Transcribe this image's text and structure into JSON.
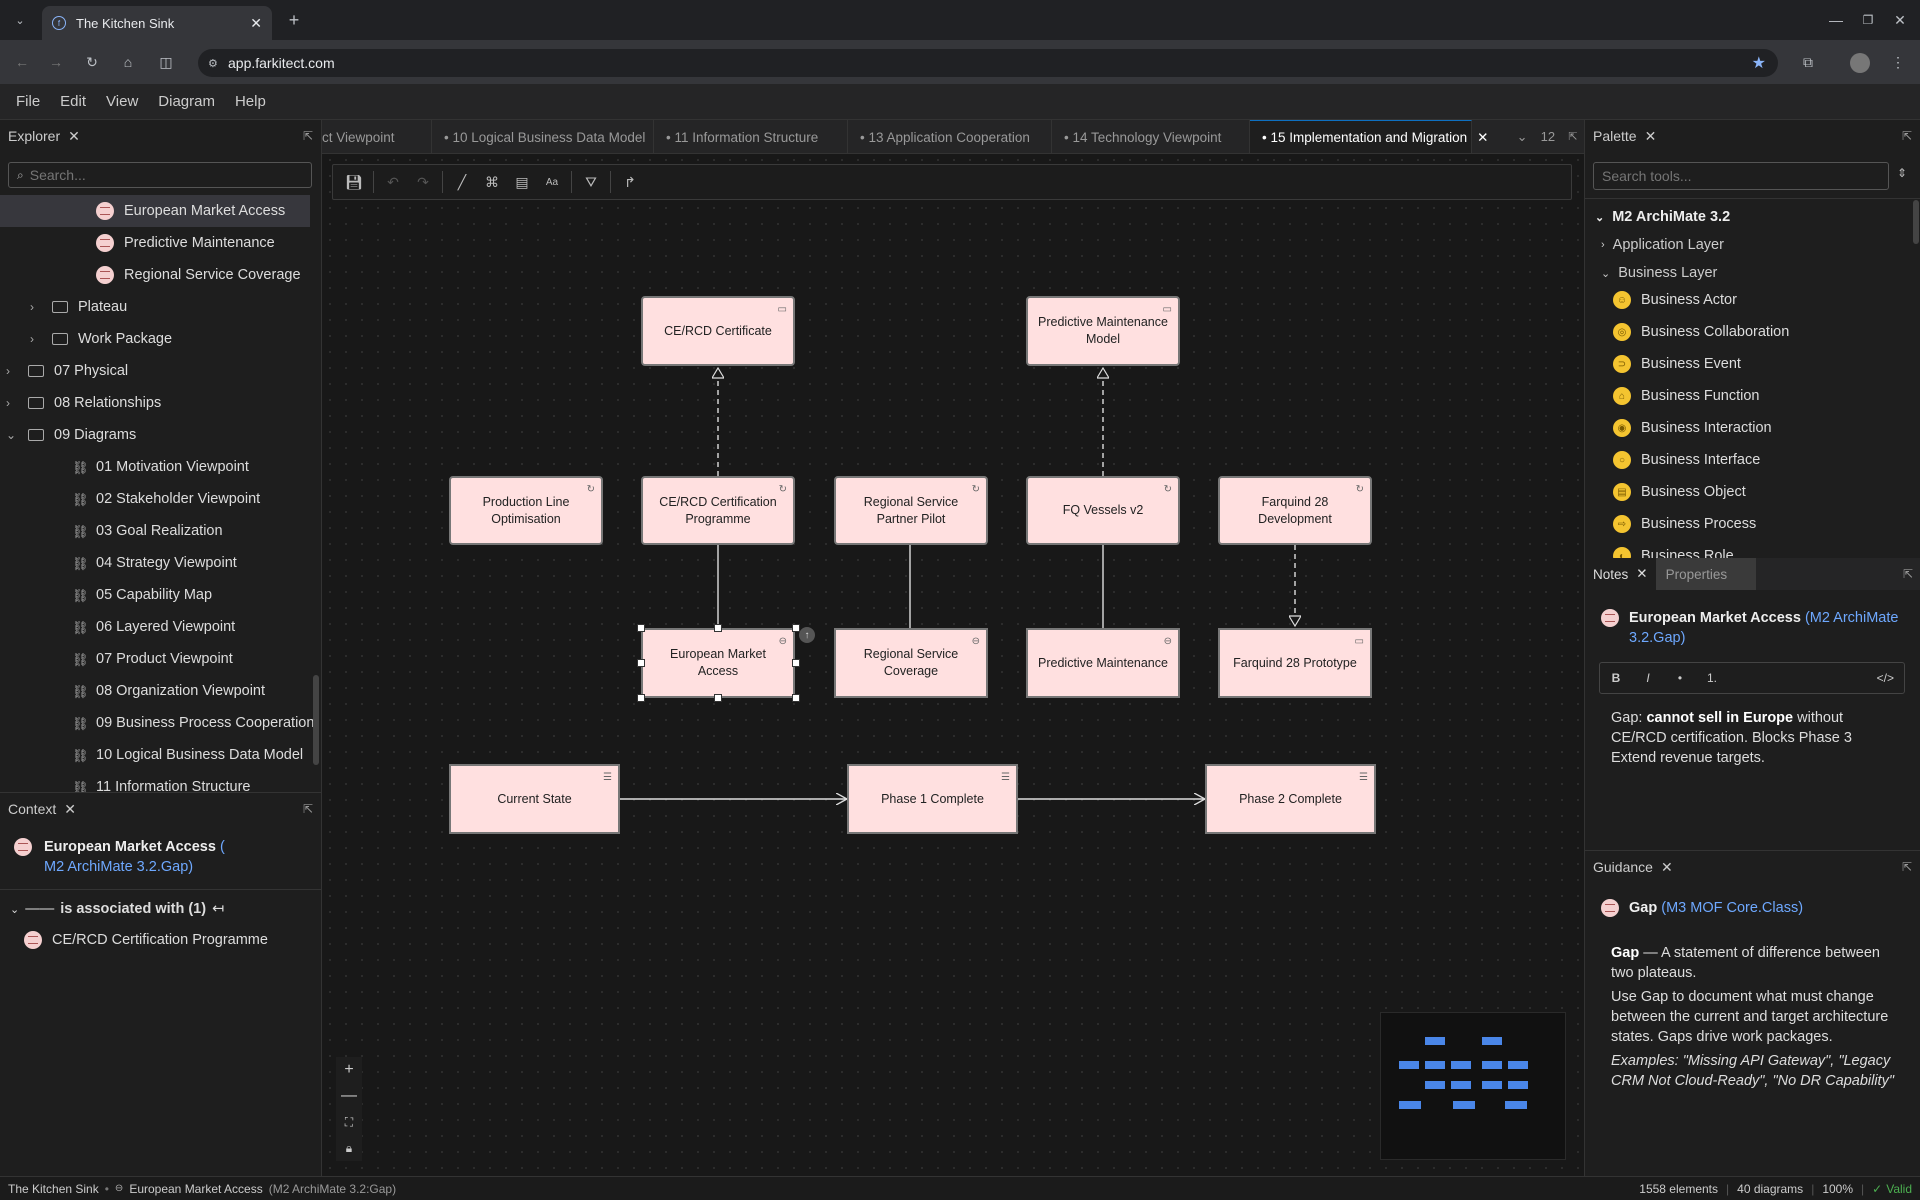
{
  "browser": {
    "tab_title": "The Kitchen Sink",
    "url": "app.farkitect.com"
  },
  "menu": [
    "File",
    "Edit",
    "View",
    "Diagram",
    "Help"
  ],
  "explorer": {
    "title": "Explorer",
    "search_placeholder": "Search...",
    "items": [
      {
        "label": "European Market Access",
        "kind": "gap",
        "indent": 2,
        "selected": true
      },
      {
        "label": "Predictive Maintenance",
        "kind": "gap",
        "indent": 2
      },
      {
        "label": "Regional Service Coverage",
        "kind": "gap",
        "indent": 2
      },
      {
        "label": "Plateau",
        "kind": "folder",
        "indent": 1,
        "chevron": "›"
      },
      {
        "label": "Work Package",
        "kind": "folder",
        "indent": 1,
        "chevron": "›"
      },
      {
        "label": "07 Physical",
        "kind": "folder",
        "indent": 0,
        "chevron": "›"
      },
      {
        "label": "08 Relationships",
        "kind": "folder",
        "indent": 0,
        "chevron": "›"
      },
      {
        "label": "09 Diagrams",
        "kind": "folder",
        "indent": 0,
        "chevron": "⌄"
      },
      {
        "label": "01 Motivation Viewpoint",
        "kind": "diagram",
        "indent": 1
      },
      {
        "label": "02 Stakeholder Viewpoint",
        "kind": "diagram",
        "indent": 1
      },
      {
        "label": "03 Goal Realization",
        "kind": "diagram",
        "indent": 1
      },
      {
        "label": "04 Strategy Viewpoint",
        "kind": "diagram",
        "indent": 1
      },
      {
        "label": "05 Capability Map",
        "kind": "diagram",
        "indent": 1
      },
      {
        "label": "06 Layered Viewpoint",
        "kind": "diagram",
        "indent": 1
      },
      {
        "label": "07 Product Viewpoint",
        "kind": "diagram",
        "indent": 1
      },
      {
        "label": "08 Organization Viewpoint",
        "kind": "diagram",
        "indent": 1
      },
      {
        "label": "09 Business Process Cooperation",
        "kind": "diagram",
        "indent": 1
      },
      {
        "label": "10 Logical Business Data Model",
        "kind": "diagram",
        "indent": 1
      },
      {
        "label": "11 Information Structure",
        "kind": "diagram",
        "indent": 1
      }
    ]
  },
  "context": {
    "title": "Context",
    "element_name": "European Market Access",
    "element_open": " (",
    "element_type": "M2 ArchiMate 3.2.Gap",
    "element_close": ")",
    "relation_label": "is associated with (1)",
    "related_item": "CE/RCD Certification Programme"
  },
  "editor_tabs": [
    {
      "label": "ct Viewpoint",
      "active": false
    },
    {
      "label": "• 10 Logical Business Data Model",
      "active": false
    },
    {
      "label": "• 11 Information Structure",
      "active": false
    },
    {
      "label": "• 13 Application Cooperation",
      "active": false
    },
    {
      "label": "• 14 Technology Viewpoint",
      "active": false
    },
    {
      "label": "• 15 Implementation and Migration",
      "active": true
    }
  ],
  "tabs_overflow": "12",
  "diagram": {
    "nodes": [
      {
        "id": "cert",
        "label": "CE/RCD Certificate"
      },
      {
        "id": "pmm",
        "label": "Predictive Maintenance Model"
      },
      {
        "id": "plo",
        "label": "Production Line Optimisation"
      },
      {
        "id": "cerp",
        "label": "CE/RCD Certification Programme"
      },
      {
        "id": "rsp",
        "label": "Regional Service Partner Pilot"
      },
      {
        "id": "fqv",
        "label": "FQ Vessels v2"
      },
      {
        "id": "f28d",
        "label": "Farquind 28 Development"
      },
      {
        "id": "ema",
        "label": "European Market Access"
      },
      {
        "id": "rsc",
        "label": "Regional Service Coverage"
      },
      {
        "id": "pm",
        "label": "Predictive Maintenance"
      },
      {
        "id": "f28p",
        "label": "Farquind 28 Prototype"
      },
      {
        "id": "cs",
        "label": "Current State"
      },
      {
        "id": "p1",
        "label": "Phase 1 Complete"
      },
      {
        "id": "p2",
        "label": "Phase 2 Complete"
      }
    ]
  },
  "palette": {
    "title": "Palette",
    "search_placeholder": "Search tools...",
    "group": "M2 ArchiMate 3.2",
    "app_layer": "Application Layer",
    "business_layer": "Business Layer",
    "items": [
      "Business Actor",
      "Business Collaboration",
      "Business Event",
      "Business Function",
      "Business Interaction",
      "Business Interface",
      "Business Object",
      "Business Process",
      "Business Role"
    ]
  },
  "notes": {
    "tab_notes": "Notes",
    "tab_properties": "Properties",
    "element_name": "European Market Access",
    "element_type": "(M2 ArchiMate 3.2.Gap)",
    "fmt_bold": "B",
    "fmt_italic": "I",
    "fmt_bullet": "•",
    "fmt_numbered": "1.",
    "fmt_code": "</>",
    "text_prefix": "Gap: ",
    "text_bold": "cannot sell in Europe",
    "text_rest": " without CE/RCD certification. Blocks Phase 3 Extend revenue targets."
  },
  "guidance": {
    "title": "Guidance",
    "element_name": "Gap",
    "element_type": "(M3 MOF Core.Class)",
    "term": "Gap",
    "definition": " — A statement of difference between two plateaus.",
    "usage": "Use Gap to document what must change between the current and target architecture states. Gaps drive work packages.",
    "examples": "Examples: \"Missing API Gateway\", \"Legacy CRM Not Cloud-Ready\", \"No DR Capability\""
  },
  "status": {
    "project": "The Kitchen Sink",
    "element": "European Market Access",
    "element_type": "(M2 ArchiMate 3.2:Gap)",
    "elements_count": "1558 elements",
    "diagrams_count": "40 diagrams",
    "zoom": "100%",
    "validity": "Valid"
  },
  "colors": {
    "accent": "#6ea8fe",
    "node_fill": "#ffe0e0",
    "business_yellow": "#f4c430",
    "minimap_block": "#4a86e8"
  }
}
